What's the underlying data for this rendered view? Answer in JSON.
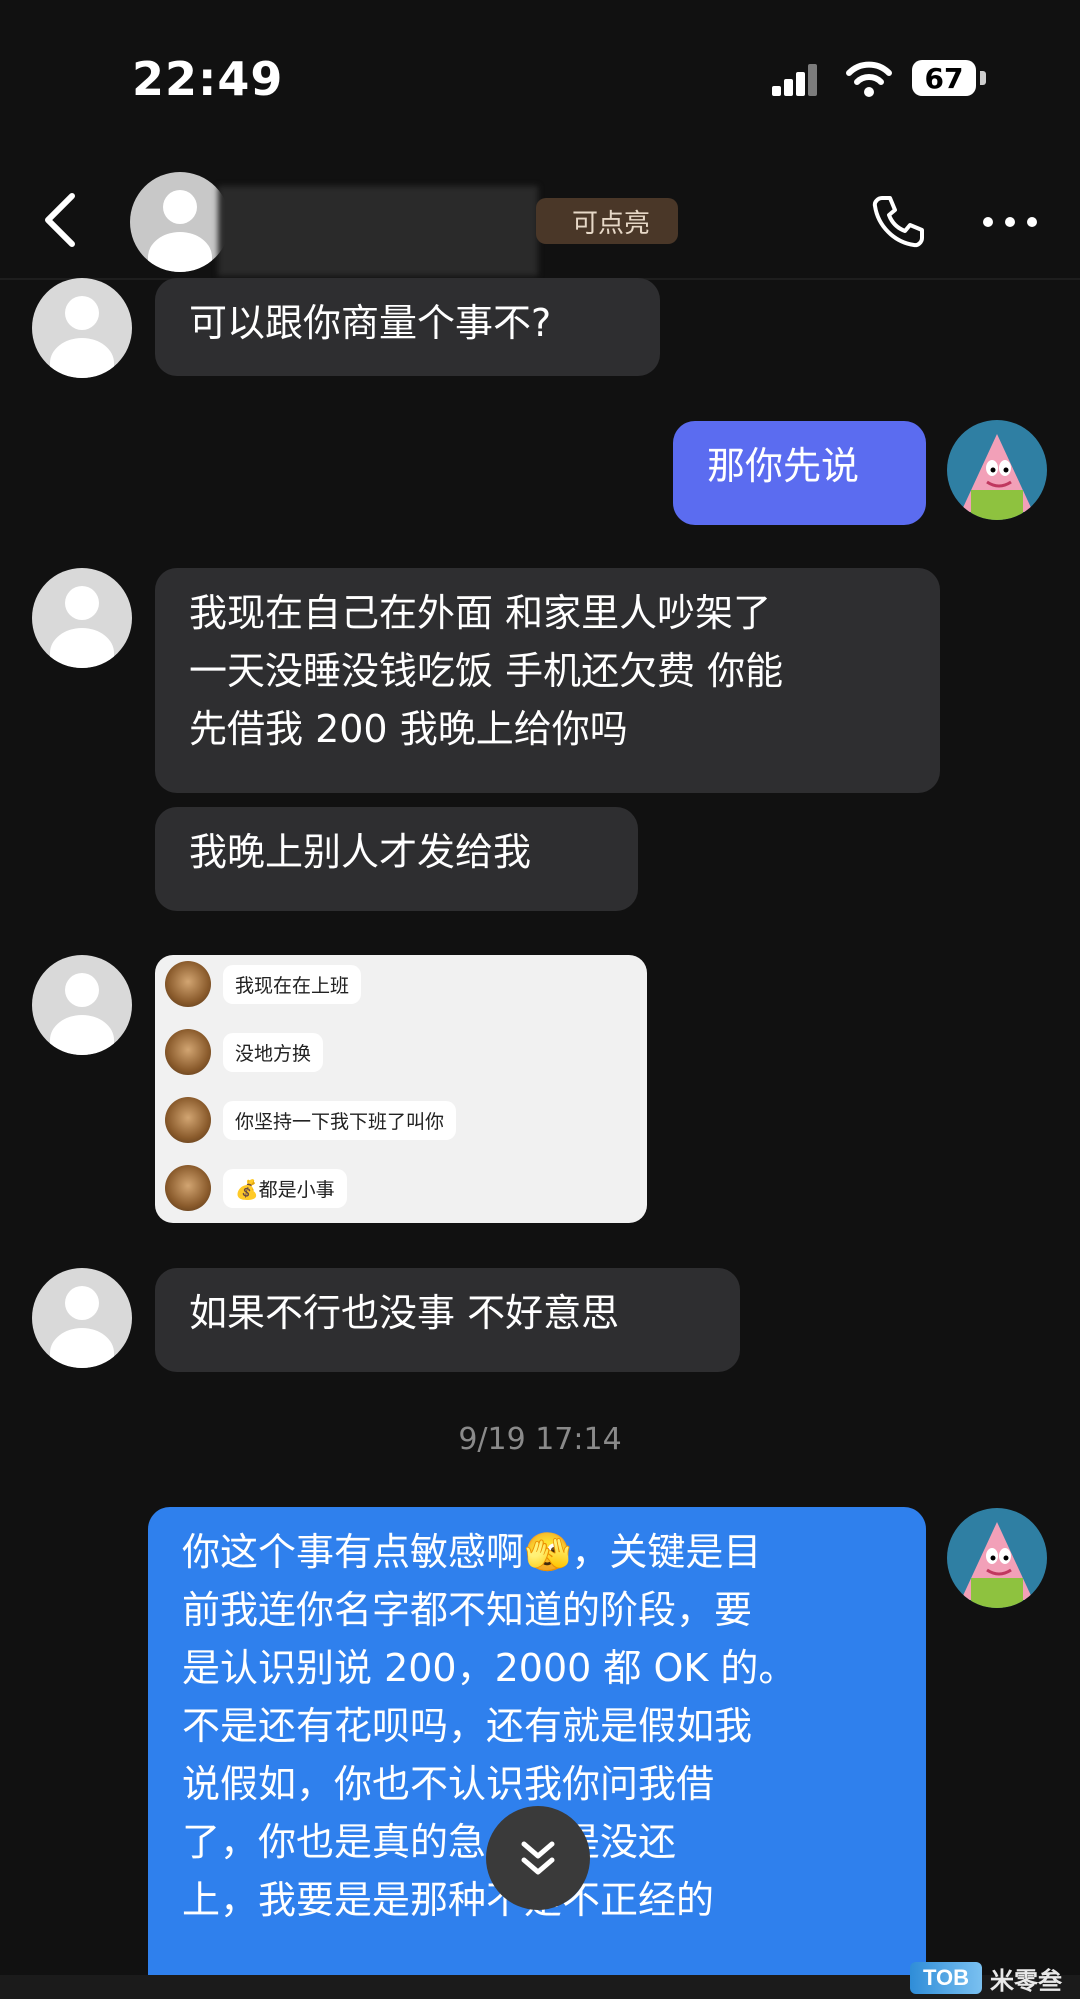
{
  "status_bar": {
    "time": "22:49",
    "battery": "67"
  },
  "header": {
    "badge": "可点亮"
  },
  "messages": [
    {
      "side": "in",
      "lines": [
        "可以跟你商量个事不?"
      ]
    },
    {
      "side": "out",
      "lines": [
        "那你先说"
      ]
    },
    {
      "side": "in",
      "lines": [
        "我现在自己在外面 和家里人吵架了",
        "一天没睡没钱吃饭 手机还欠费 你能",
        "先借我 200 我晚上给你吗"
      ]
    },
    {
      "side": "in",
      "lines": [
        "我晚上别人才发给我"
      ]
    },
    {
      "side": "in",
      "lines": [
        "如果不行也没事 不好意思"
      ]
    },
    {
      "side": "out",
      "lines": [
        "你这个事有点敏感啊🫣，关键是目",
        "前我连你名字都不知道的阶段，要",
        "是认识别说 200，2000 都 OK 的。",
        "不是还有花呗吗，还有就是假如我",
        "说假如，你也不认识我你问我借",
        "了，你也是真的急，但是没还",
        "上，我要是是那种不是不正经的"
      ]
    }
  ],
  "embedded_chat": [
    "我现在在上班",
    "没地方换",
    "你坚持一下我下班了叫你",
    "💰都是小事"
  ],
  "timestamp": "9/19 17:14",
  "watermark": {
    "logo": "TOB",
    "text": "米零叁"
  },
  "colors": {
    "background": "#111111",
    "bubble_in": "#2e2e30",
    "bubble_out_purple": "#5b6cf0",
    "bubble_out_blue": "#2f80ed"
  },
  "icons": [
    "back-icon",
    "phone-icon",
    "more-icon",
    "flame-icon",
    "chevron-double-down-icon",
    "signal-icon",
    "wifi-icon"
  ]
}
